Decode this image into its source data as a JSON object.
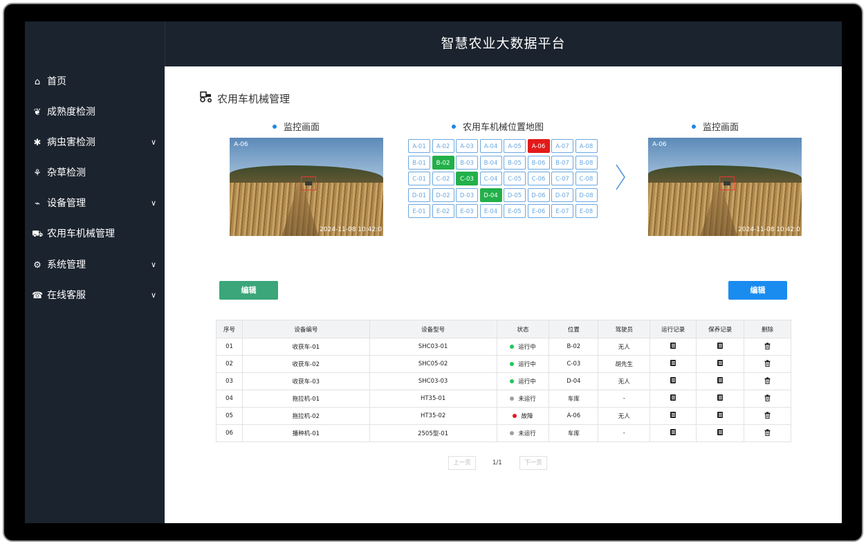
{
  "app": {
    "title": "智慧农业大数据平台"
  },
  "sidebar": {
    "items": [
      {
        "label": "首页",
        "icon": "home-icon",
        "glyph": "⌂",
        "has_children": false
      },
      {
        "label": "成熟度检测",
        "icon": "apple-icon",
        "glyph": "❦",
        "has_children": false
      },
      {
        "label": "病虫害检测",
        "icon": "bug-icon",
        "glyph": "✱",
        "has_children": true
      },
      {
        "label": "杂草检测",
        "icon": "seedling-icon",
        "glyph": "⚘",
        "has_children": false
      },
      {
        "label": "设备管理",
        "icon": "device-icon",
        "glyph": "⌁",
        "has_children": true
      },
      {
        "label": "农用车机械管理",
        "icon": "tractor-icon",
        "glyph": "⛟",
        "has_children": false
      },
      {
        "label": "系统管理",
        "icon": "gear-icon",
        "glyph": "⚙",
        "has_children": true
      },
      {
        "label": "在线客服",
        "icon": "headset-icon",
        "glyph": "☎",
        "has_children": true
      }
    ],
    "chevron": "∨"
  },
  "main": {
    "section_title": "农用车机械管理",
    "left_panel": {
      "caption": "监控画面",
      "cam_id": "A-06",
      "timestamp": "2024-11-08 10:42:0"
    },
    "map_panel": {
      "caption": "农用车机械位置地图",
      "rows": [
        [
          "A-01",
          "A-02",
          "A-03",
          "A-04",
          "A-05",
          "A-06",
          "A-07",
          "A-08"
        ],
        [
          "B-01",
          "B-02",
          "B-03",
          "B-04",
          "B-05",
          "B-06",
          "B-07",
          "B-08"
        ],
        [
          "C-01",
          "C-02",
          "C-03",
          "C-04",
          "C-05",
          "C-06",
          "C-07",
          "C-08"
        ],
        [
          "D-01",
          "D-02",
          "D-03",
          "D-04",
          "D-05",
          "D-06",
          "D-07",
          "D-08"
        ],
        [
          "E-01",
          "E-02",
          "E-03",
          "E-04",
          "E-05",
          "E-06",
          "E-07",
          "E-08"
        ]
      ],
      "highlight": {
        "A-06": "red",
        "B-02": "green",
        "C-03": "green",
        "D-04": "green"
      }
    },
    "right_panel": {
      "caption": "监控画面",
      "cam_id": "A-06",
      "timestamp": "2024-11-08 10:42:0"
    },
    "edit_left_label": "编辑",
    "edit_right_label": "编辑",
    "table": {
      "headers": [
        "序号",
        "设备编号",
        "设备型号",
        "状态",
        "位置",
        "驾驶员",
        "运行记录",
        "保养记录",
        "删除"
      ],
      "rows": [
        {
          "no": "01",
          "code": "收获车-01",
          "model": "SHC03-01",
          "status": "运行中",
          "status_color": "#22c55e",
          "pos": "B-02",
          "driver": "无人"
        },
        {
          "no": "02",
          "code": "收获车-02",
          "model": "SHC05-02",
          "status": "运行中",
          "status_color": "#22c55e",
          "pos": "C-03",
          "driver": "胡先生"
        },
        {
          "no": "03",
          "code": "收获车-03",
          "model": "SHC03-03",
          "status": "运行中",
          "status_color": "#22c55e",
          "pos": "D-04",
          "driver": "无人"
        },
        {
          "no": "04",
          "code": "拖拉机-01",
          "model": "HT35-01",
          "status": "未运行",
          "status_color": "#9e9e9e",
          "pos": "车库",
          "driver": "-"
        },
        {
          "no": "05",
          "code": "拖拉机-02",
          "model": "HT35-02",
          "status": "故障",
          "status_color": "#e31a1a",
          "pos": "A-06",
          "driver": "无人"
        },
        {
          "no": "06",
          "code": "播种机-01",
          "model": "2505型-01",
          "status": "未运行",
          "status_color": "#9e9e9e",
          "pos": "车库",
          "driver": "-"
        }
      ]
    },
    "pager": {
      "prev": "上一页",
      "current": "1/1",
      "next": "下一页"
    }
  },
  "colors": {
    "sidebar_bg": "#1b232e",
    "accent_blue": "#1a8cf0",
    "accent_green": "#3aa67a",
    "cell_border": "#6aa7e0"
  }
}
